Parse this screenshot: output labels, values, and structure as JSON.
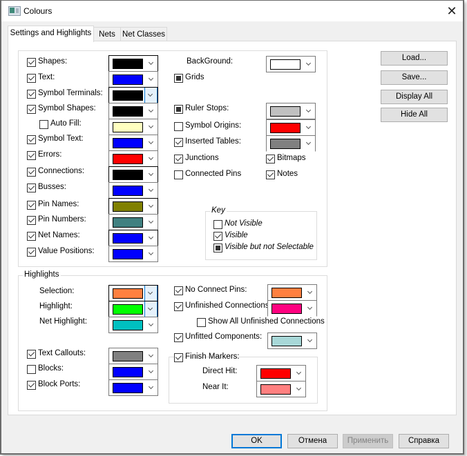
{
  "window": {
    "title": "Colours",
    "app_icon": "app-window-icon",
    "close_icon": "close-icon"
  },
  "tabs": [
    {
      "label": "Settings and Highlights",
      "active": true
    },
    {
      "label": "Nets",
      "active": false
    },
    {
      "label": "Net Classes",
      "active": false
    }
  ],
  "display": {
    "items": [
      {
        "label": "Shapes:",
        "state": "checked",
        "color": "#000000"
      },
      {
        "label": "Text:",
        "state": "checked",
        "color": "#0000ff"
      },
      {
        "label": "Symbol Terminals:",
        "state": "checked",
        "color": "#000000"
      },
      {
        "label": "Symbol Shapes:",
        "state": "checked",
        "color": "#000000"
      },
      {
        "label": "Auto Fill:",
        "state": "unchecked",
        "color": "#ffffc0"
      },
      {
        "label": "Symbol Text:",
        "state": "checked",
        "color": "#0000ff"
      },
      {
        "label": "Errors:",
        "state": "checked",
        "color": "#ff0000"
      },
      {
        "label": "Connections:",
        "state": "checked",
        "color": "#000000"
      },
      {
        "label": "Busses:",
        "state": "checked",
        "color": "#0000ff"
      },
      {
        "label": "Pin Names:",
        "state": "checked",
        "color": "#808000"
      },
      {
        "label": "Pin Numbers:",
        "state": "checked",
        "color": "#408080"
      },
      {
        "label": "Net Names:",
        "state": "checked",
        "color": "#0000ff"
      },
      {
        "label": "Value Positions:",
        "state": "checked",
        "color": "#0000ff"
      }
    ],
    "background": {
      "label": "BackGround:",
      "color": "#ffffff"
    },
    "grids": {
      "label": "Grids",
      "state": "indeterminate"
    },
    "ruler_stops": {
      "label": "Ruler Stops:",
      "state": "indeterminate",
      "color": "#c0c0c0"
    },
    "symbol_origins": {
      "label": "Symbol Origins:",
      "state": "unchecked",
      "color": "#ff0000"
    },
    "inserted_tables": {
      "label": "Inserted Tables:",
      "state": "checked",
      "color": "#808080"
    },
    "junctions": {
      "label": "Junctions",
      "state": "checked"
    },
    "connected_pins": {
      "label": "Connected Pins",
      "state": "unchecked"
    },
    "bitmaps": {
      "label": "Bitmaps",
      "state": "checked"
    },
    "notes": {
      "label": "Notes",
      "state": "checked"
    }
  },
  "key": {
    "title": "Key",
    "items": [
      {
        "label": "Not Visible",
        "state": "unchecked"
      },
      {
        "label": "Visible",
        "state": "checked"
      },
      {
        "label": "Visible but not Selectable",
        "state": "indeterminate"
      }
    ]
  },
  "highlights": {
    "title": "Highlights",
    "selection": {
      "label": "Selection:",
      "color": "#ff8040"
    },
    "highlight": {
      "label": "Highlight:",
      "color": "#00ff00"
    },
    "net_highlight": {
      "label": "Net Highlight:",
      "color": "#00c0c0"
    },
    "text_callouts": {
      "label": "Text Callouts:",
      "state": "checked",
      "color": "#808080"
    },
    "blocks": {
      "label": "Blocks:",
      "state": "unchecked",
      "color": "#0000ff"
    },
    "block_ports": {
      "label": "Block Ports:",
      "state": "checked",
      "color": "#0000ff"
    },
    "no_connect_pins": {
      "label": "No Connect Pins:",
      "state": "checked",
      "color": "#ff8040"
    },
    "unfinished_connections": {
      "label": "Unfinished Connections:",
      "state": "checked",
      "color": "#ff0080"
    },
    "show_all_unfinished": {
      "label": "Show All Unfinished Connections",
      "state": "unchecked"
    },
    "unfitted_components": {
      "label": "Unfitted Components:",
      "state": "checked",
      "color": "#a8d8d8"
    },
    "finish_markers": {
      "label": "Finish Markers:",
      "state": "checked"
    },
    "direct_hit": {
      "label": "Direct Hit:",
      "color": "#ff0000"
    },
    "near_it": {
      "label": "Near It:",
      "color": "#ff8080"
    }
  },
  "side_buttons": {
    "load": "Load...",
    "save": "Save...",
    "display_all": "Display All",
    "hide_all": "Hide All"
  },
  "footer": {
    "ok": "OK",
    "cancel": "Отмена",
    "apply": "Применить",
    "help": "Справка"
  }
}
